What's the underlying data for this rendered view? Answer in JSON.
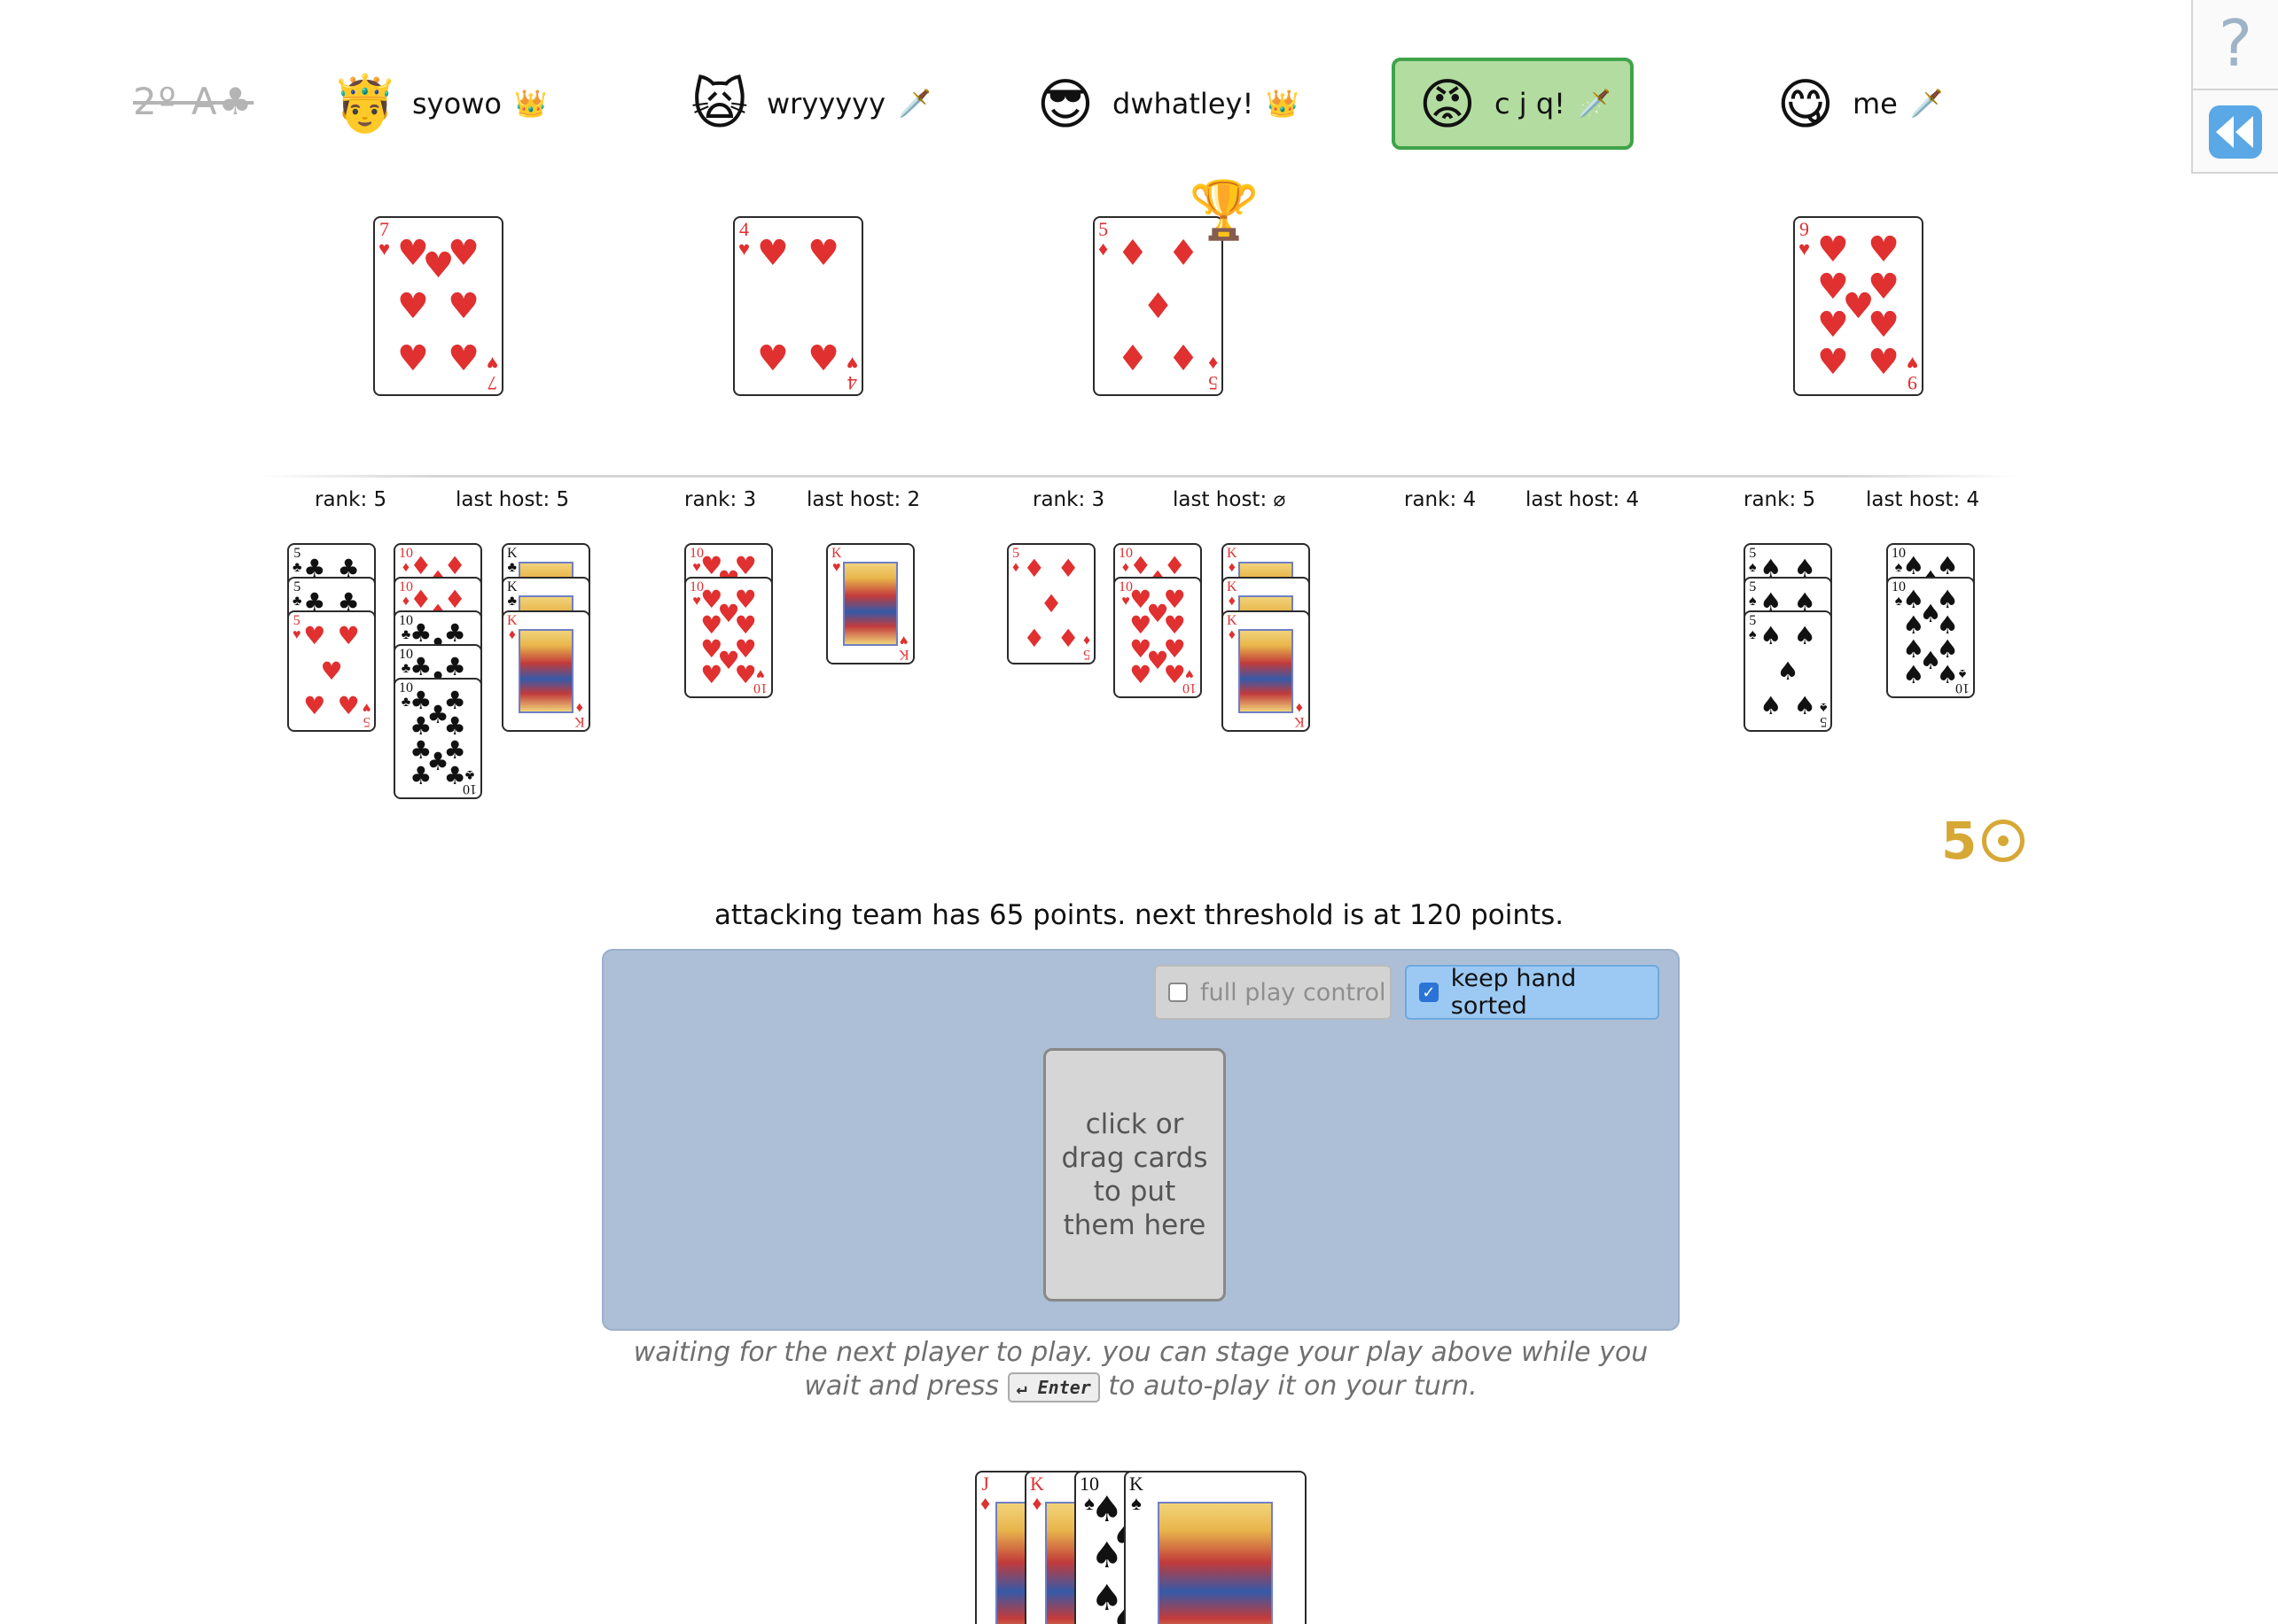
{
  "trump": "2º A♣",
  "help_icon": "?",
  "players": [
    {
      "name": "syowo",
      "role": "👑",
      "avatar": "🤴"
    },
    {
      "name": "wryyyyy",
      "role": "🗡️",
      "avatar": "🙀"
    },
    {
      "name": "dwhatley!",
      "role": "👑",
      "avatar": "😎"
    },
    {
      "name": "c j q!",
      "role": "🗡️",
      "avatar": "😡",
      "active": true
    },
    {
      "name": "me",
      "role": "🗡️",
      "avatar": "😋"
    }
  ],
  "current_trick": [
    {
      "player": "syowo",
      "rank": "7",
      "suit": "♥"
    },
    {
      "player": "wryyyyy",
      "rank": "4",
      "suit": "♥"
    },
    {
      "player": "dwhatley!",
      "rank": "5",
      "suit": "♦",
      "winning": true
    },
    {
      "player": "me",
      "rank": "9",
      "suit": "♥"
    }
  ],
  "trophy_icon": "🏆",
  "stats": [
    {
      "rank_label": "rank: 5",
      "host_label": "last host: 5"
    },
    {
      "rank_label": "rank: 3",
      "host_label": "last host: 2"
    },
    {
      "rank_label": "rank: 3",
      "host_label": "last host: ⌀"
    },
    {
      "rank_label": "rank: 4",
      "host_label": "last host: 4"
    },
    {
      "rank_label": "rank: 5",
      "host_label": "last host: 4"
    }
  ],
  "points_cards": [
    [
      [
        "5♣",
        "5♣",
        "5♥"
      ],
      [
        "10♦",
        "10♦",
        "10♣",
        "10♣",
        "10♣"
      ],
      [
        "K♣",
        "K♣",
        "K♦"
      ]
    ],
    [
      [
        "10♥",
        "10♥"
      ],
      [
        "K♥"
      ]
    ],
    [
      [
        "5♦"
      ],
      [
        "10♦",
        "10♥"
      ],
      [
        "K♦",
        "K♦",
        "K♦"
      ]
    ],
    [],
    [
      [
        "5♠",
        "5♠",
        "5♠"
      ],
      [
        "10♠",
        "10♠"
      ]
    ]
  ],
  "trick_count": "5",
  "status_line": "attacking team has 65 points. next threshold is at 120 points.",
  "controls": {
    "full_play_control": "full play control",
    "keep_hand_sorted": "keep hand sorted",
    "full_play_checked": false,
    "keep_sorted_checked": true
  },
  "stage_hint": "click or drag cards to put them here",
  "waiting_before": "waiting for the next player to play. you can stage your play above while you wait and press",
  "enter_key": "↵ Enter",
  "waiting_after": "to auto-play it on your turn.",
  "hand": [
    "J♦",
    "K♦",
    "10♠",
    "K♠"
  ],
  "colors": {
    "accent_gold": "#d6a835",
    "play_area": "#adbfd6",
    "active_player": "#b3dca0"
  }
}
